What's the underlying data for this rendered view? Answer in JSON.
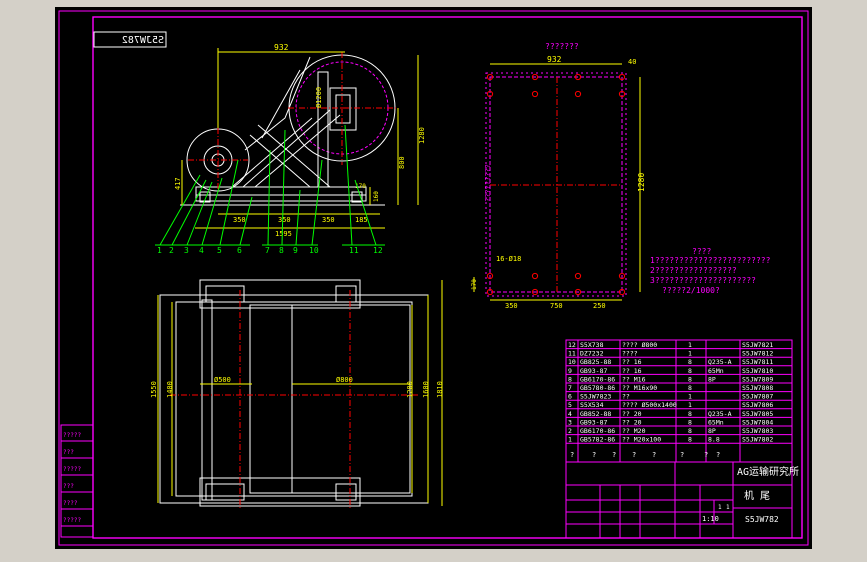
{
  "colors": {
    "background": "#000000",
    "frame": "#ff00ff",
    "outline": "#ffffff",
    "dimension": "#ffff00",
    "leader": "#00ff00",
    "centerline": "#ff0000",
    "hidden": "#ff00ff",
    "parts": "#00ffff",
    "chrome": "#d4d0c8"
  },
  "drawing": {
    "title_box_mirrored": "S5JW782",
    "front_view": {
      "dim_top": "932",
      "dim_drive_diameter": "Ø1200",
      "dim_height_1280": "1280",
      "dim_height_800": "800",
      "dim_left_417": "417",
      "dim_170": "170",
      "dim_160": "160",
      "dim_bottom_350a": "350",
      "dim_bottom_350b": "350",
      "dim_bottom_350c": "350",
      "dim_bottom_185": "185",
      "dim_overall_1595": "1595",
      "balloons": [
        "1",
        "2",
        "3",
        "4",
        "5",
        "6",
        "7",
        "8",
        "9",
        "10",
        "11",
        "12"
      ]
    },
    "plan_view": {
      "heading": "???????",
      "dim_932": "932",
      "dim_40": "40",
      "dim_1280": "1280",
      "side_label": "?????????",
      "hole_label": "16-Ø18",
      "dim_170": "170",
      "dim_350": "350",
      "dim_750": "750",
      "dim_250": "250",
      "notes_title": "????",
      "notes": [
        "1????????????????????????",
        "2?????????????????",
        "3?????????????????????",
        "?????2/1000?"
      ]
    },
    "top_view": {
      "dim_1550": "1550",
      "dim_1400": "1400",
      "dim_1200": "1200",
      "dim_1600": "1600",
      "dim_1810": "1810",
      "label_d500": "Ø500",
      "label_d800": "Ø800"
    },
    "bom": [
      {
        "no": "12",
        "code": "S5X738",
        "name": "???? Ø800",
        "qty": "1",
        "mat": "",
        "note": "S5JW7821"
      },
      {
        "no": "11",
        "code": "DZ7232",
        "name": "????",
        "qty": "1",
        "mat": "",
        "note": "S5JW7812"
      },
      {
        "no": "10",
        "code": "GB825-88",
        "name": "?? 16",
        "qty": "8",
        "mat": "Q235-A",
        "note": "S5JW7811"
      },
      {
        "no": "9",
        "code": "GB93-87",
        "name": "?? 16",
        "qty": "8",
        "mat": "65Mn",
        "note": "S5JW7810"
      },
      {
        "no": "8",
        "code": "GB6170-86",
        "name": "?? M16",
        "qty": "8",
        "mat": "8P",
        "note": "S5JW7809"
      },
      {
        "no": "7",
        "code": "GB5780-86",
        "name": "?? M16x90",
        "qty": "8",
        "mat": "",
        "note": "S5JW7808"
      },
      {
        "no": "6",
        "code": "S5JW7823",
        "name": "??",
        "qty": "1",
        "mat": "",
        "note": "S5JW7807"
      },
      {
        "no": "5",
        "code": "S5X534",
        "name": "???? Ø500x1400",
        "qty": "1",
        "mat": "",
        "note": "S5JW7806"
      },
      {
        "no": "4",
        "code": "GB852-88",
        "name": "?? 20",
        "qty": "8",
        "mat": "Q235-A",
        "note": "S5JW7805"
      },
      {
        "no": "3",
        "code": "GB93-87",
        "name": "?? 20",
        "qty": "8",
        "mat": "65Mn",
        "note": "S5JW7804"
      },
      {
        "no": "2",
        "code": "GB6170-86",
        "name": "?? M20",
        "qty": "8",
        "mat": "8P",
        "note": "S5JW7803"
      },
      {
        "no": "1",
        "code": "GB5782-86",
        "name": "?? M20x100",
        "qty": "8",
        "mat": "8.8",
        "note": "S5JW7802"
      }
    ],
    "bom_header": [
      "?",
      "?",
      "?",
      "?",
      "?",
      "?",
      "?",
      "?"
    ],
    "institute": "AG运输研究所",
    "part_title": "机 尾",
    "drawing_no": "S5JW782",
    "scale_label": "1:10",
    "sheet_labels": [
      "1",
      "1"
    ],
    "left_strip": [
      "?????",
      "???",
      "?????",
      "???",
      "????",
      "?????"
    ]
  }
}
